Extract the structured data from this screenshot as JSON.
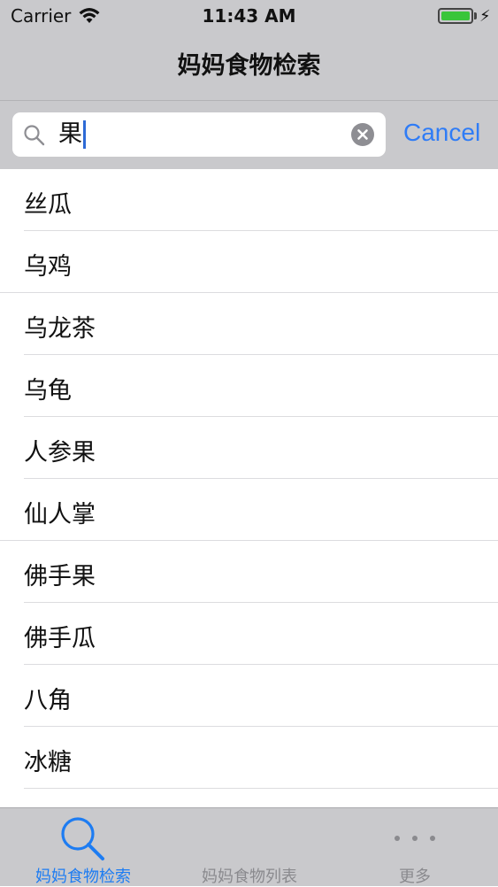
{
  "status_bar": {
    "carrier": "Carrier",
    "time": "11:43 AM",
    "battery_color": "#39c53a"
  },
  "nav": {
    "title": "妈妈食物检索"
  },
  "search": {
    "query": "果",
    "cancel_label": "Cancel",
    "accent_color": "#2f7cf6"
  },
  "results": [
    {
      "label": "丝瓜"
    },
    {
      "label": "乌鸡"
    },
    {
      "label": "乌龙茶"
    },
    {
      "label": "乌龟"
    },
    {
      "label": "人参果"
    },
    {
      "label": "仙人掌"
    },
    {
      "label": "佛手果"
    },
    {
      "label": "佛手瓜"
    },
    {
      "label": "八角"
    },
    {
      "label": "冰糖"
    }
  ],
  "tabbar": {
    "tabs": [
      {
        "label": "妈妈食物检索",
        "icon": "search-icon",
        "active": true
      },
      {
        "label": "妈妈食物列表",
        "icon": "list-icon",
        "active": false
      },
      {
        "label": "更多",
        "icon": "more-icon",
        "active": false
      }
    ]
  }
}
